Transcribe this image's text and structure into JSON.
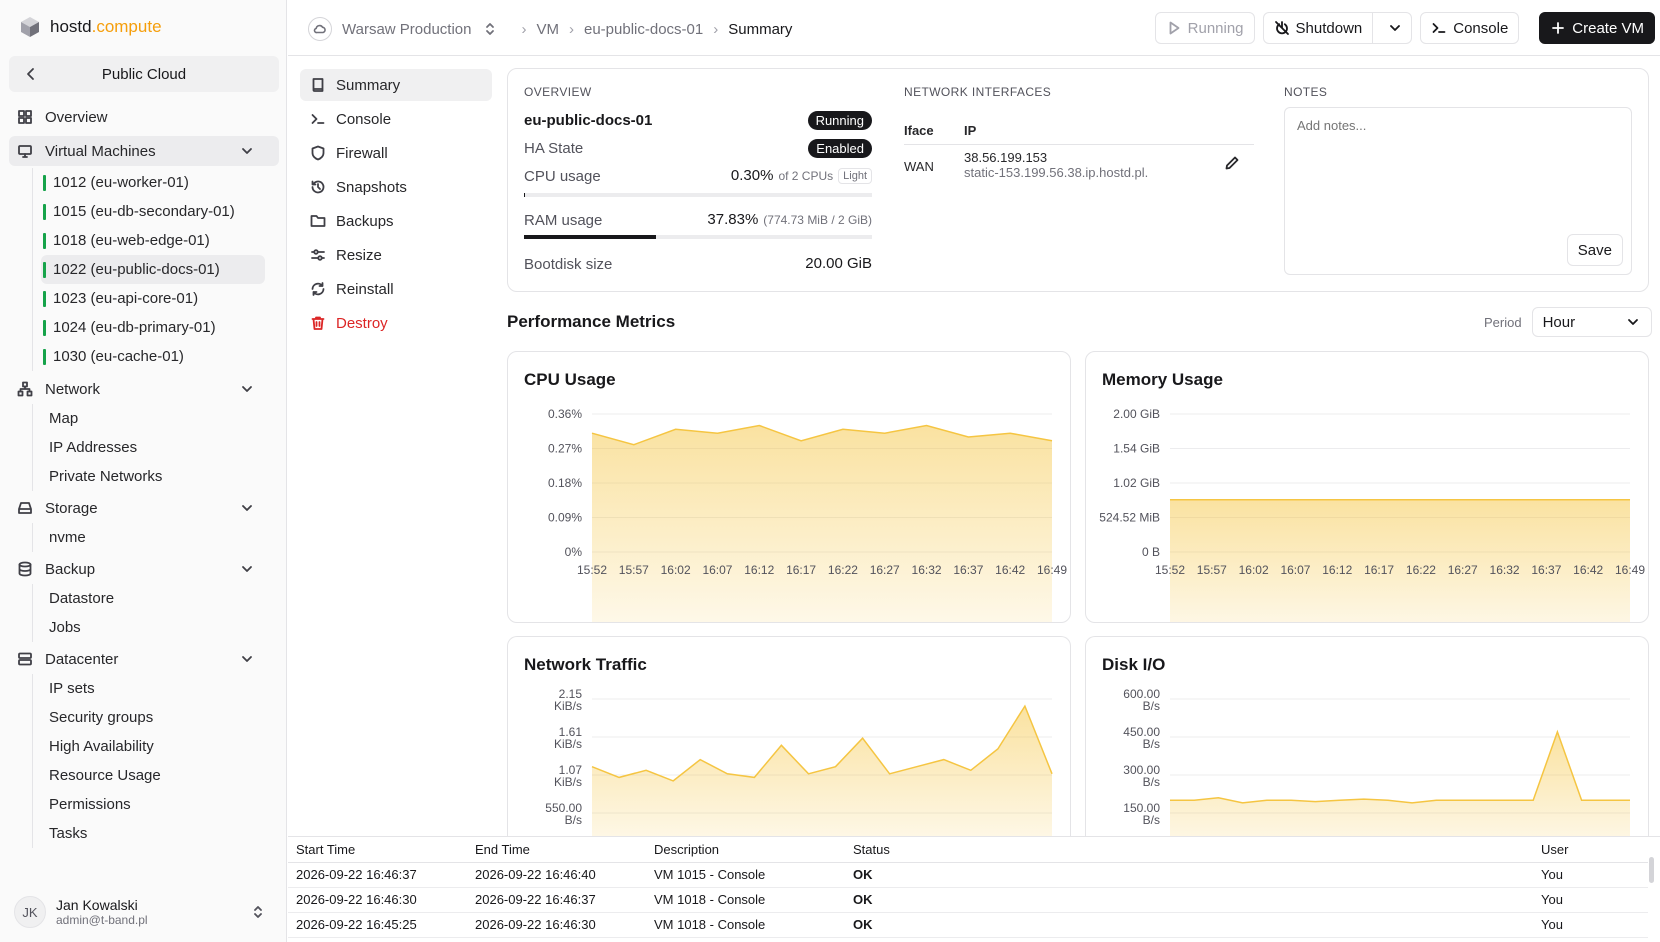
{
  "brand": {
    "name": "hostd",
    "suffix": ".compute"
  },
  "sidebar": {
    "scope": "Public Cloud",
    "overview": "Overview",
    "virtual_machines": "Virtual Machines",
    "vms": [
      "1012 (eu-worker-01)",
      "1015 (eu-db-secondary-01)",
      "1018 (eu-web-edge-01)",
      "1022 (eu-public-docs-01)",
      "1023 (eu-api-core-01)",
      "1024 (eu-db-primary-01)",
      "1030 (eu-cache-01)"
    ],
    "network": "Network",
    "network_items": [
      "Map",
      "IP Addresses",
      "Private Networks"
    ],
    "storage": "Storage",
    "storage_items": [
      "nvme"
    ],
    "backup": "Backup",
    "backup_items": [
      "Datastore",
      "Jobs"
    ],
    "datacenter": "Datacenter",
    "datacenter_items": [
      "IP sets",
      "Security groups",
      "High Availability",
      "Resource Usage",
      "Permissions",
      "Tasks"
    ]
  },
  "user": {
    "initials": "JK",
    "name": "Jan Kowalski",
    "email": "admin@t-band.pl"
  },
  "topbar": {
    "datacenter": "Warsaw Production",
    "crumb_vm": "VM",
    "crumb_name": "eu-public-docs-01",
    "crumb_current": "Summary",
    "running": "Running",
    "shutdown": "Shutdown",
    "console": "Console",
    "create_vm": "Create VM"
  },
  "subnav": [
    "Summary",
    "Console",
    "Firewall",
    "Snapshots",
    "Backups",
    "Resize",
    "Reinstall",
    "Destroy"
  ],
  "overview": {
    "heading": "Overview",
    "name": "eu-public-docs-01",
    "status": "Running",
    "ha_label": "HA State",
    "ha_value": "Enabled",
    "cpu_label": "CPU usage",
    "cpu_value": "0.30%",
    "cpu_detail": "of 2 CPUs",
    "cpu_tag": "Light",
    "cpu_fraction": 0.003,
    "ram_label": "RAM usage",
    "ram_value": "37.83%",
    "ram_detail": "(774.73 MiB / 2 GiB)",
    "ram_fraction": 0.3783,
    "disk_label": "Bootdisk size",
    "disk_value": "20.00 GiB"
  },
  "network_interfaces": {
    "heading": "Network Interfaces",
    "col_iface": "Iface",
    "col_ip": "IP",
    "iface": "WAN",
    "ip": "38.56.199.153",
    "host": "static-153.199.56.38.ip.hostd.pl."
  },
  "notes": {
    "heading": "Notes",
    "placeholder": "Add notes...",
    "save": "Save"
  },
  "metrics": {
    "heading": "Performance Metrics",
    "period_label": "Period",
    "period_value": "Hour"
  },
  "chart_data": [
    {
      "type": "area",
      "title": "CPU Usage",
      "x": [
        "15:52",
        "15:57",
        "16:02",
        "16:07",
        "16:12",
        "16:17",
        "16:22",
        "16:27",
        "16:32",
        "16:37",
        "16:42",
        "16:49"
      ],
      "yticks": [
        "0%",
        "0.09%",
        "0.18%",
        "0.27%",
        "0.36%"
      ],
      "ylim": [
        0,
        0.36
      ],
      "values": [
        0.31,
        0.28,
        0.32,
        0.31,
        0.33,
        0.29,
        0.32,
        0.31,
        0.33,
        0.3,
        0.31,
        0.29
      ],
      "color": "#f5c542"
    },
    {
      "type": "area",
      "title": "Memory Usage",
      "x": [
        "15:52",
        "15:57",
        "16:02",
        "16:07",
        "16:12",
        "16:17",
        "16:22",
        "16:27",
        "16:32",
        "16:37",
        "16:42",
        "16:49"
      ],
      "yticks": [
        "0 B",
        "524.52 MiB",
        "1.02 GiB",
        "1.54 GiB",
        "2.00 GiB"
      ],
      "ylim": [
        0,
        2048
      ],
      "values": [
        775,
        775,
        775,
        775,
        775,
        775,
        775,
        775,
        775,
        775,
        775,
        775
      ],
      "color": "#f5c542"
    },
    {
      "type": "area",
      "title": "Network Traffic",
      "x": [],
      "yticks": [
        "550.00 B/s",
        "1.07 KiB/s",
        "1.61 KiB/s",
        "2.15 KiB/s"
      ],
      "ylim": [
        0,
        2.15
      ],
      "values": [
        1.2,
        1.05,
        1.15,
        1.0,
        1.3,
        1.1,
        1.05,
        1.5,
        1.1,
        1.2,
        1.6,
        1.1,
        1.2,
        1.3,
        1.15,
        1.45,
        2.05,
        1.1
      ],
      "color": "#f5c542"
    },
    {
      "type": "area",
      "title": "Disk I/O",
      "x": [],
      "yticks": [
        "150.00 B/s",
        "300.00 B/s",
        "450.00 B/s",
        "600.00 B/s"
      ],
      "ylim": [
        0,
        600
      ],
      "values": [
        200,
        200,
        210,
        190,
        200,
        200,
        195,
        200,
        205,
        200,
        190,
        200,
        200,
        200,
        200,
        200,
        470,
        200,
        200,
        200
      ],
      "color": "#f5c542"
    }
  ],
  "tasks": {
    "headers": [
      "Start Time",
      "End Time",
      "Description",
      "Status",
      "User"
    ],
    "rows": [
      [
        "2026-09-22 16:46:37",
        "2026-09-22 16:46:40",
        "VM 1015 - Console",
        "OK",
        "You"
      ],
      [
        "2026-09-22 16:46:30",
        "2026-09-22 16:46:37",
        "VM 1018 - Console",
        "OK",
        "You"
      ],
      [
        "2026-09-22 16:45:25",
        "2026-09-22 16:46:30",
        "VM 1018 - Console",
        "OK",
        "You"
      ]
    ]
  }
}
